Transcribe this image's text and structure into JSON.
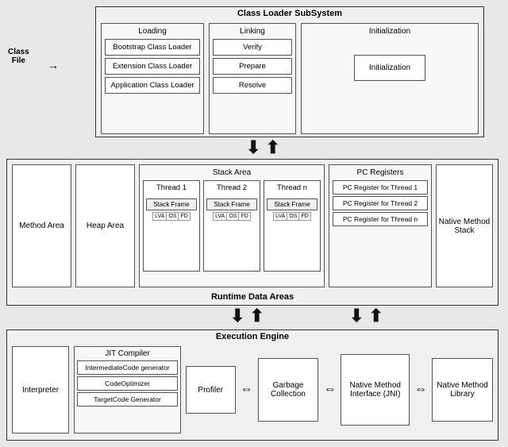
{
  "classLoader": {
    "title": "Class Loader SubSystem",
    "loading": {
      "title": "Loading",
      "boxes": [
        "Bootstrap Class Loader",
        "Extension Class Loader",
        "Application Class Loader"
      ]
    },
    "linking": {
      "title": "Linking",
      "boxes": [
        "Verify",
        "Prepare",
        "Resolve"
      ]
    },
    "initialization": {
      "title": "Initialization",
      "box": "Initialization"
    }
  },
  "classFile": {
    "line1": "Class",
    "line2": "File"
  },
  "runtimeData": {
    "title": "Runtime Data Areas",
    "methodArea": "Method Area",
    "heapArea": "Heap Area",
    "stackArea": {
      "title": "Stack Area",
      "threads": [
        {
          "name": "Thread 1",
          "frameLabel": "Stack Frame",
          "cells": [
            "LVA",
            "OS",
            "FD"
          ]
        },
        {
          "name": "Thread 2",
          "frameLabel": "Stack Frame",
          "cells": [
            "LVA",
            "OS",
            "FD"
          ]
        },
        {
          "name": "Thread n",
          "frameLabel": "Stack Frame",
          "cells": [
            "LVA",
            "OS",
            "FD"
          ]
        }
      ]
    },
    "pcRegisters": {
      "title": "PC Registers",
      "boxes": [
        "PC Register for Thread 1",
        "PC Register for Thread 2",
        "PC Register for Thread n"
      ]
    },
    "nativeMethodStack": "Native Method Stack"
  },
  "executionEngine": {
    "title": "Execution Engine",
    "interpreter": "Interpreter",
    "jitCompiler": {
      "title": "JIT Compiler",
      "boxes": [
        "IntermediateCode generator",
        "CodeOptimizer",
        "TargetCode Generator"
      ]
    },
    "profiler": "Profiler",
    "garbageCollection": "Garbage Collection",
    "nativeMethodInterface": "Native Method Interface (JNI)",
    "nativeMethodLibrary": "Native Method Library"
  }
}
